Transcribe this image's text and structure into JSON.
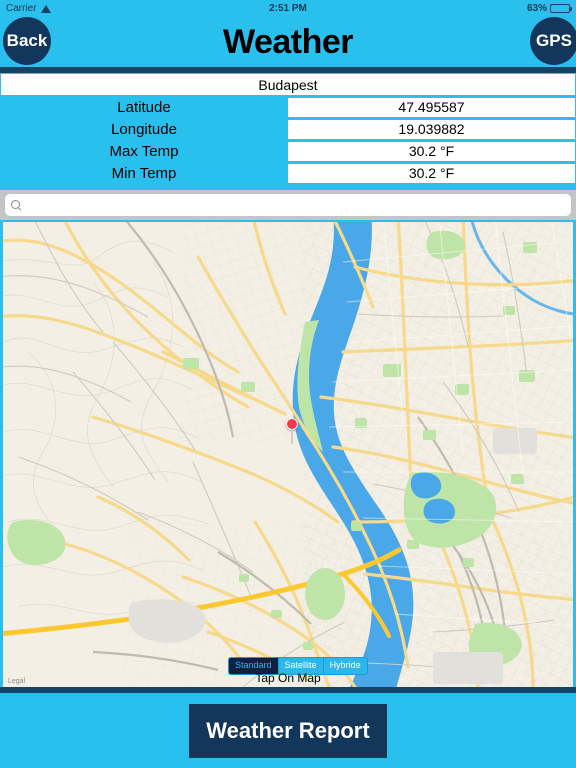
{
  "status_bar": {
    "carrier": "Carrier",
    "wifi_icon": "wifi-icon",
    "time": "2:51 PM",
    "battery_percent": "63%",
    "battery_icon": "battery-icon"
  },
  "nav": {
    "back_label": "Back",
    "title": "Weather",
    "gps_label": "GPS"
  },
  "info": {
    "city": "Budapest",
    "rows": [
      {
        "label": "Latitude",
        "value": "47.495587"
      },
      {
        "label": "Longitude",
        "value": "19.039882"
      },
      {
        "label": "Max Temp",
        "value": "30.2 °F"
      },
      {
        "label": "Min Temp",
        "value": "30.2 °F"
      }
    ]
  },
  "search": {
    "value": "",
    "placeholder": "",
    "icon": "search-icon"
  },
  "map": {
    "legal_label": "Legal",
    "pin_icon": "map-pin-icon",
    "tap_hint": "Tap On Map",
    "segments": [
      {
        "label": "Standard",
        "selected": true
      },
      {
        "label": "Satellite",
        "selected": false
      },
      {
        "label": "Hybride",
        "selected": false
      }
    ]
  },
  "footer": {
    "report_button": "Weather Report"
  },
  "colors": {
    "background_cyan": "#29c0ee",
    "navy": "#13365b",
    "divider_navy": "#134466",
    "map_land": "#f3efe4",
    "map_water": "#4aa7e8",
    "map_park": "#b9e3a4",
    "map_road_major": "#f8d889",
    "map_motorway": "#fcc832",
    "pin_red": "#f5384a",
    "search_bar_gray": "#c3c6c8"
  }
}
